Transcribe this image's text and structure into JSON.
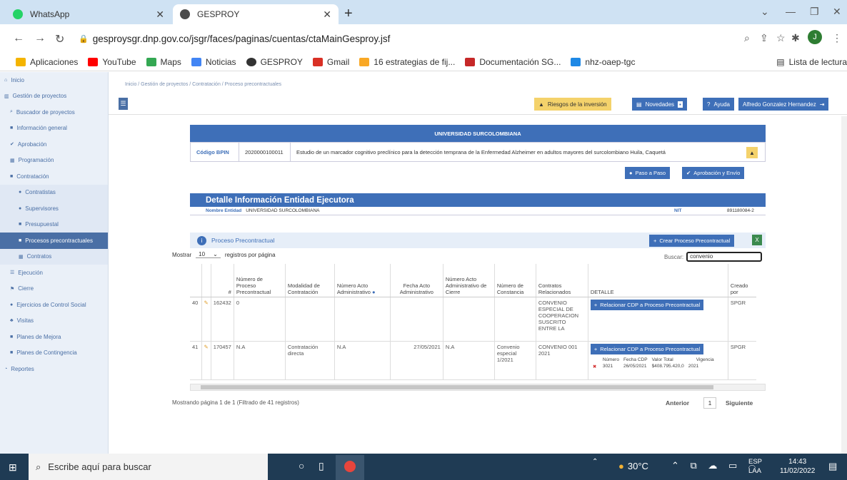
{
  "browser": {
    "tabs": [
      {
        "title": "WhatsApp",
        "color": "#25d366"
      },
      {
        "title": "GESPROY",
        "color": "#4b4b4b"
      }
    ],
    "url": "gesproysgr.dnp.gov.co/jsgr/faces/paginas/cuentas/ctaMainGesproy.jsf",
    "bookmarks": [
      {
        "label": "Aplicaciones",
        "color": "#f4b400"
      },
      {
        "label": "YouTube",
        "color": "#ff0000"
      },
      {
        "label": "Maps",
        "color": "#34a853"
      },
      {
        "label": "Noticias",
        "color": "#4285f4"
      },
      {
        "label": "GESPROY",
        "color": "#333333"
      },
      {
        "label": "Gmail",
        "color": "#d93025"
      },
      {
        "label": "16 estrategias de fij...",
        "color": "#f9a825"
      },
      {
        "label": "Documentación SG...",
        "color": "#c62828"
      },
      {
        "label": "nhz-oaep-tgc",
        "color": "#1e88e5"
      }
    ],
    "reading_list": "Lista de lectura",
    "profile_initial": "J"
  },
  "sidebar": {
    "items": [
      {
        "label": "Inicio",
        "level": 0
      },
      {
        "label": "Gestión de proyectos",
        "level": 0
      },
      {
        "label": "Buscador de proyectos",
        "level": 1
      },
      {
        "label": "Información general",
        "level": 1
      },
      {
        "label": "Aprobación",
        "level": 1
      },
      {
        "label": "Programación",
        "level": 1
      },
      {
        "label": "Contratación",
        "level": 1
      },
      {
        "label": "Contratistas",
        "level": 2
      },
      {
        "label": "Supervisores",
        "level": 2
      },
      {
        "label": "Presupuestal",
        "level": 2
      },
      {
        "label": "Procesos precontractuales",
        "level": 2,
        "active": true
      },
      {
        "label": "Contratos",
        "level": 2
      },
      {
        "label": "Ejecución",
        "level": 1
      },
      {
        "label": "Cierre",
        "level": 1
      },
      {
        "label": "Ejercicios de Control Social",
        "level": 1
      },
      {
        "label": "Visitas",
        "level": 1
      },
      {
        "label": "Planes de Mejora",
        "level": 1
      },
      {
        "label": "Planes de Contingencia",
        "level": 1
      },
      {
        "label": "Reportes",
        "level": 0
      }
    ]
  },
  "breadcrumb": "Inicio  /  Gestión de proyectos / Contratación / Proceso precontractuales",
  "topbar": {
    "riesgos": "Riesgos de la inversión",
    "novedades": "Novedades",
    "ayuda": "Ayuda",
    "user": "Alfredo Gonzalez Hernandez"
  },
  "entity": {
    "name": "UNIVERSIDAD SURCOLOMBIANA",
    "bpin_label": "Código BPIN",
    "bpin": "2020000100011",
    "description": "Estudio de un marcador cognitivo preclínico para la detección temprana de la Enfermedad Alzheimer en adultos mayores del surcolombiano Huila, Caquetá"
  },
  "actions": {
    "paso": "Paso a Paso",
    "aprobacion": "Aprobación y Envío"
  },
  "detalle": {
    "title": "Detalle Información Entidad Ejecutora",
    "nombre_label": "Nombre Entidad",
    "nombre": "UNIVERSIDAD SURCOLOMBIANA",
    "nit_label": "NIT",
    "nit": "891180084-2"
  },
  "proceso": {
    "title": "Proceso Precontractual",
    "crear": "Crear Proceso Precontractual",
    "mostrar": "Mostrar",
    "page_size": "10",
    "registros": "registros por página",
    "buscar": "Buscar:",
    "search_value": "convenio",
    "columns": [
      "#",
      "Número de Proceso Precontractual",
      "Modalidad de Contratación",
      "Número Acto Administrativo",
      "Fecha Acto Administrativo",
      "Número Acto Administrativo de Cierre",
      "Número de Constancia",
      "Contratos Relacionados",
      "DETALLE",
      "Creado por"
    ],
    "rows": [
      {
        "idx": "40",
        "num": "162432",
        "proc": "0",
        "modalidad": "",
        "acto": "",
        "fecha": "",
        "cierre": "",
        "constancia": "",
        "contratos": "CONVENIO ESPECIAL DE COOPERACION SUSCRITO ENTRE LA",
        "creado": "SPGR"
      },
      {
        "idx": "41",
        "num": "170457",
        "proc": "N.A",
        "modalidad": "Contratación directa",
        "acto": "N.A",
        "fecha": "27/05/2021",
        "cierre": "N.A",
        "constancia": "Convenio especial 1/2021",
        "contratos": "CONVENIO 001 2021",
        "creado": "SPGR"
      }
    ],
    "relacionar": "Relacionar CDP a Proceso Precontractual",
    "cdp_headers": [
      "Número",
      "Fecha CDP",
      "Valor Total",
      "Vigencia"
    ],
    "cdp_row": [
      "3021",
      "26/05/2021",
      "$408.795.420,0",
      "2021"
    ],
    "footer_info": "Mostrando página 1 de 1 (Filtrado de 41 registros)",
    "anterior": "Anterior",
    "page": "1",
    "siguiente": "Siguiente"
  },
  "taskbar": {
    "search": "Escribe aquí para buscar",
    "temp": "30°C",
    "lang1": "ESP",
    "lang2": "LAA",
    "time": "14:43",
    "date": "11/02/2022"
  }
}
